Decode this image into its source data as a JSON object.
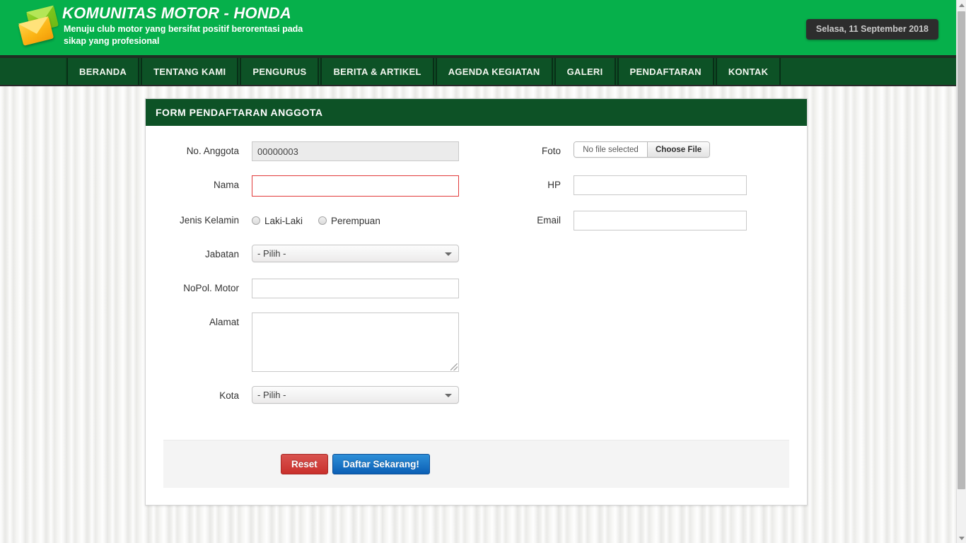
{
  "header": {
    "title": "KOMUNITAS MOTOR - HONDA",
    "tagline": "Menuju club motor yang bersifat positif berorentasi pada sikap yang profesional",
    "date_badge": "Selasa, 11 September 2018",
    "logo_icon": "envelope-icon",
    "brand_green": "#06b04b",
    "nav_green": "#0d5226"
  },
  "nav": {
    "items": [
      {
        "label": "BERANDA"
      },
      {
        "label": "TENTANG KAMI"
      },
      {
        "label": "PENGURUS"
      },
      {
        "label": "BERITA & ARTIKEL"
      },
      {
        "label": "AGENDA KEGIATAN"
      },
      {
        "label": "GALERI"
      },
      {
        "label": "PENDAFTARAN"
      },
      {
        "label": "KONTAK"
      }
    ]
  },
  "panel": {
    "title": "FORM PENDAFTARAN ANGGOTA"
  },
  "form": {
    "left": {
      "no_anggota": {
        "label": "No. Anggota",
        "value": "00000003",
        "readonly": true
      },
      "nama": {
        "label": "Nama",
        "value": "",
        "placeholder": "",
        "invalid": true
      },
      "jenis_kelamin": {
        "label": "Jenis Kelamin",
        "options": [
          {
            "label": "Laki-Laki",
            "selected": false
          },
          {
            "label": "Perempuan",
            "selected": false
          }
        ]
      },
      "jabatan": {
        "label": "Jabatan",
        "selected": "- Pilih -"
      },
      "nopol_motor": {
        "label": "NoPol. Motor",
        "value": "",
        "placeholder": ""
      },
      "alamat": {
        "label": "Alamat",
        "value": "",
        "placeholder": ""
      },
      "kota": {
        "label": "Kota",
        "selected": "- Pilih -"
      }
    },
    "right": {
      "foto": {
        "label": "Foto",
        "file_name": "No file selected",
        "choose_label": "Choose File"
      },
      "hp": {
        "label": "HP",
        "value": "",
        "placeholder": ""
      },
      "email": {
        "label": "Email",
        "value": "",
        "placeholder": ""
      }
    }
  },
  "actions": {
    "reset_label": "Reset",
    "submit_label": "Daftar Sekarang!",
    "reset_color": "#c9302c",
    "submit_color": "#0b5fb5"
  },
  "scrollbar": {
    "up_icon": "scroll-up-arrow-icon",
    "down_icon": "scroll-down-arrow-icon"
  }
}
